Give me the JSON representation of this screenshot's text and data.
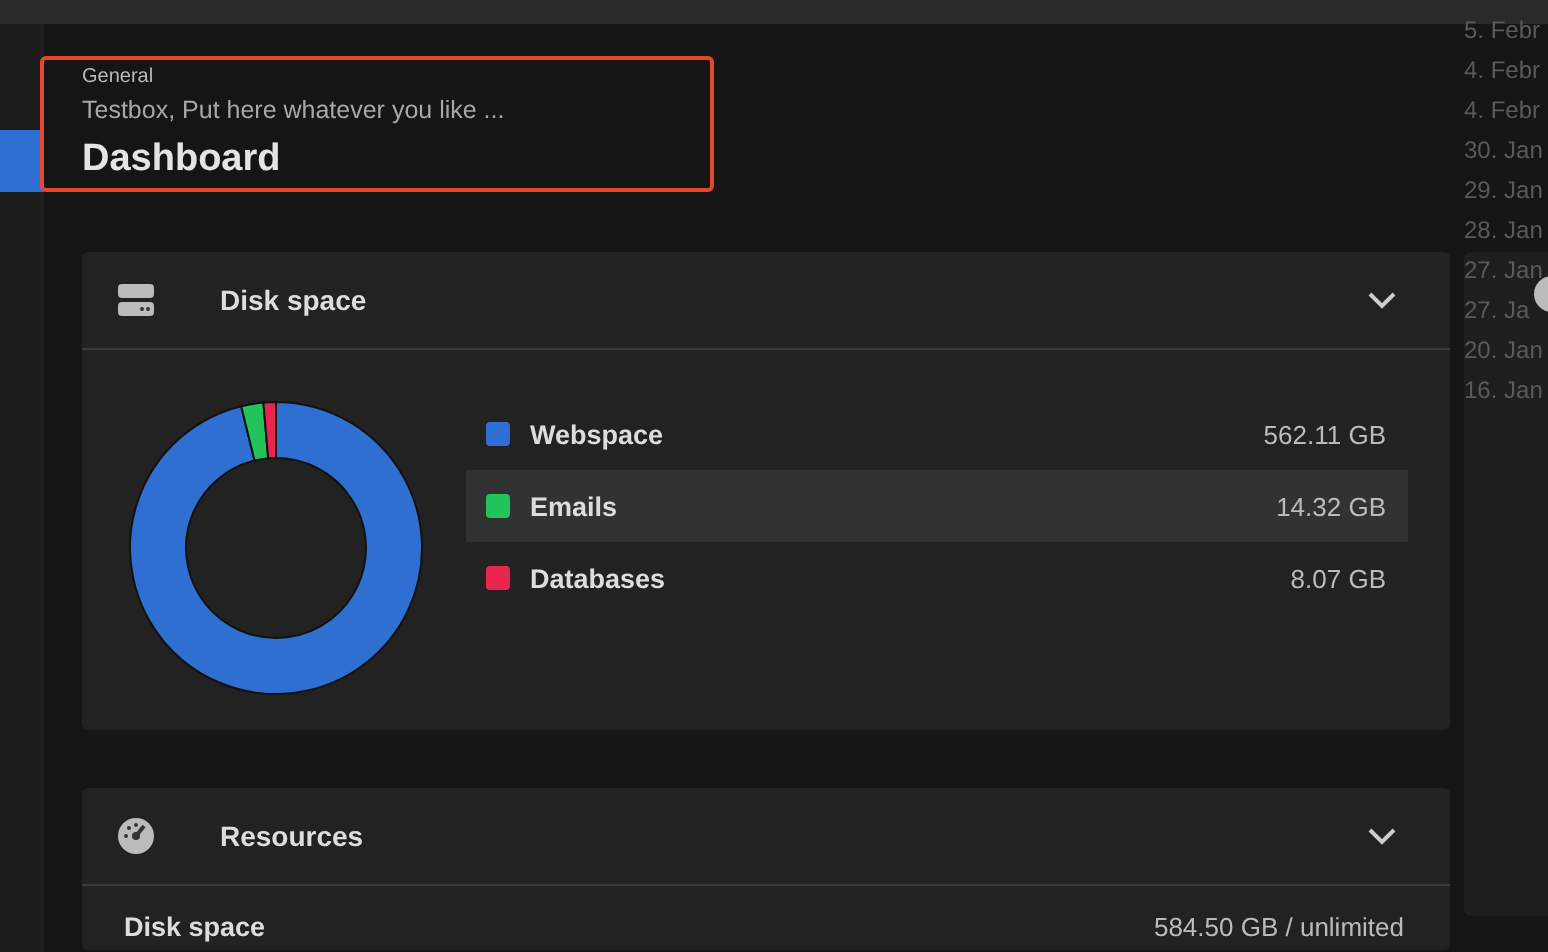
{
  "background_window": {
    "dates": [
      "5. Febr",
      "4. Febr",
      "4. Febr",
      "30. Jan",
      "29. Jan",
      "28. Jan",
      "27. Jan",
      "27. Ja",
      "20. Jan",
      "16. Jan"
    ]
  },
  "sidebar": {
    "items": [
      {
        "selected": true
      }
    ]
  },
  "header": {
    "breadcrumb": "General",
    "note": "Testbox, Put here whatever you like ...",
    "title": "Dashboard"
  },
  "cards": [
    {
      "kind": "chart",
      "title": "Disk space",
      "expanded": true,
      "legend": [
        {
          "label": "Webspace",
          "value": "562.11 GB",
          "color": "#2f6fd2",
          "selected": false
        },
        {
          "label": "Emails",
          "value": "14.32 GB",
          "color": "#22c35a",
          "selected": true
        },
        {
          "label": "Databases",
          "value": "8.07 GB",
          "color": "#e8264f",
          "selected": false
        }
      ]
    },
    {
      "kind": "list",
      "title": "Resources",
      "expanded": true,
      "rows": [
        {
          "label": "Disk space",
          "value": "584.50 GB / unlimited"
        }
      ]
    }
  ]
}
